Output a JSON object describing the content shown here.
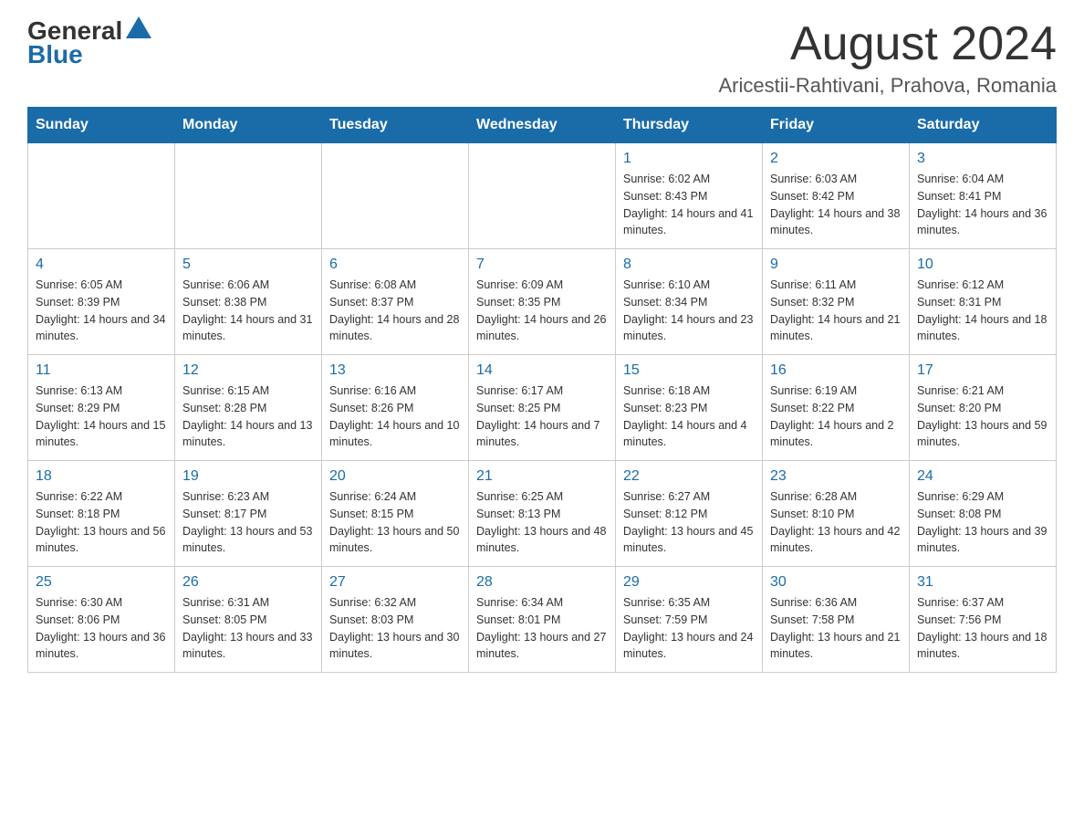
{
  "header": {
    "logo_general": "General",
    "logo_blue": "Blue",
    "title": "August 2024",
    "subtitle": "Aricestii-Rahtivani, Prahova, Romania"
  },
  "days_of_week": [
    "Sunday",
    "Monday",
    "Tuesday",
    "Wednesday",
    "Thursday",
    "Friday",
    "Saturday"
  ],
  "weeks": [
    [
      {
        "day": "",
        "info": ""
      },
      {
        "day": "",
        "info": ""
      },
      {
        "day": "",
        "info": ""
      },
      {
        "day": "",
        "info": ""
      },
      {
        "day": "1",
        "info": "Sunrise: 6:02 AM\nSunset: 8:43 PM\nDaylight: 14 hours and 41 minutes."
      },
      {
        "day": "2",
        "info": "Sunrise: 6:03 AM\nSunset: 8:42 PM\nDaylight: 14 hours and 38 minutes."
      },
      {
        "day": "3",
        "info": "Sunrise: 6:04 AM\nSunset: 8:41 PM\nDaylight: 14 hours and 36 minutes."
      }
    ],
    [
      {
        "day": "4",
        "info": "Sunrise: 6:05 AM\nSunset: 8:39 PM\nDaylight: 14 hours and 34 minutes."
      },
      {
        "day": "5",
        "info": "Sunrise: 6:06 AM\nSunset: 8:38 PM\nDaylight: 14 hours and 31 minutes."
      },
      {
        "day": "6",
        "info": "Sunrise: 6:08 AM\nSunset: 8:37 PM\nDaylight: 14 hours and 28 minutes."
      },
      {
        "day": "7",
        "info": "Sunrise: 6:09 AM\nSunset: 8:35 PM\nDaylight: 14 hours and 26 minutes."
      },
      {
        "day": "8",
        "info": "Sunrise: 6:10 AM\nSunset: 8:34 PM\nDaylight: 14 hours and 23 minutes."
      },
      {
        "day": "9",
        "info": "Sunrise: 6:11 AM\nSunset: 8:32 PM\nDaylight: 14 hours and 21 minutes."
      },
      {
        "day": "10",
        "info": "Sunrise: 6:12 AM\nSunset: 8:31 PM\nDaylight: 14 hours and 18 minutes."
      }
    ],
    [
      {
        "day": "11",
        "info": "Sunrise: 6:13 AM\nSunset: 8:29 PM\nDaylight: 14 hours and 15 minutes."
      },
      {
        "day": "12",
        "info": "Sunrise: 6:15 AM\nSunset: 8:28 PM\nDaylight: 14 hours and 13 minutes."
      },
      {
        "day": "13",
        "info": "Sunrise: 6:16 AM\nSunset: 8:26 PM\nDaylight: 14 hours and 10 minutes."
      },
      {
        "day": "14",
        "info": "Sunrise: 6:17 AM\nSunset: 8:25 PM\nDaylight: 14 hours and 7 minutes."
      },
      {
        "day": "15",
        "info": "Sunrise: 6:18 AM\nSunset: 8:23 PM\nDaylight: 14 hours and 4 minutes."
      },
      {
        "day": "16",
        "info": "Sunrise: 6:19 AM\nSunset: 8:22 PM\nDaylight: 14 hours and 2 minutes."
      },
      {
        "day": "17",
        "info": "Sunrise: 6:21 AM\nSunset: 8:20 PM\nDaylight: 13 hours and 59 minutes."
      }
    ],
    [
      {
        "day": "18",
        "info": "Sunrise: 6:22 AM\nSunset: 8:18 PM\nDaylight: 13 hours and 56 minutes."
      },
      {
        "day": "19",
        "info": "Sunrise: 6:23 AM\nSunset: 8:17 PM\nDaylight: 13 hours and 53 minutes."
      },
      {
        "day": "20",
        "info": "Sunrise: 6:24 AM\nSunset: 8:15 PM\nDaylight: 13 hours and 50 minutes."
      },
      {
        "day": "21",
        "info": "Sunrise: 6:25 AM\nSunset: 8:13 PM\nDaylight: 13 hours and 48 minutes."
      },
      {
        "day": "22",
        "info": "Sunrise: 6:27 AM\nSunset: 8:12 PM\nDaylight: 13 hours and 45 minutes."
      },
      {
        "day": "23",
        "info": "Sunrise: 6:28 AM\nSunset: 8:10 PM\nDaylight: 13 hours and 42 minutes."
      },
      {
        "day": "24",
        "info": "Sunrise: 6:29 AM\nSunset: 8:08 PM\nDaylight: 13 hours and 39 minutes."
      }
    ],
    [
      {
        "day": "25",
        "info": "Sunrise: 6:30 AM\nSunset: 8:06 PM\nDaylight: 13 hours and 36 minutes."
      },
      {
        "day": "26",
        "info": "Sunrise: 6:31 AM\nSunset: 8:05 PM\nDaylight: 13 hours and 33 minutes."
      },
      {
        "day": "27",
        "info": "Sunrise: 6:32 AM\nSunset: 8:03 PM\nDaylight: 13 hours and 30 minutes."
      },
      {
        "day": "28",
        "info": "Sunrise: 6:34 AM\nSunset: 8:01 PM\nDaylight: 13 hours and 27 minutes."
      },
      {
        "day": "29",
        "info": "Sunrise: 6:35 AM\nSunset: 7:59 PM\nDaylight: 13 hours and 24 minutes."
      },
      {
        "day": "30",
        "info": "Sunrise: 6:36 AM\nSunset: 7:58 PM\nDaylight: 13 hours and 21 minutes."
      },
      {
        "day": "31",
        "info": "Sunrise: 6:37 AM\nSunset: 7:56 PM\nDaylight: 13 hours and 18 minutes."
      }
    ]
  ]
}
